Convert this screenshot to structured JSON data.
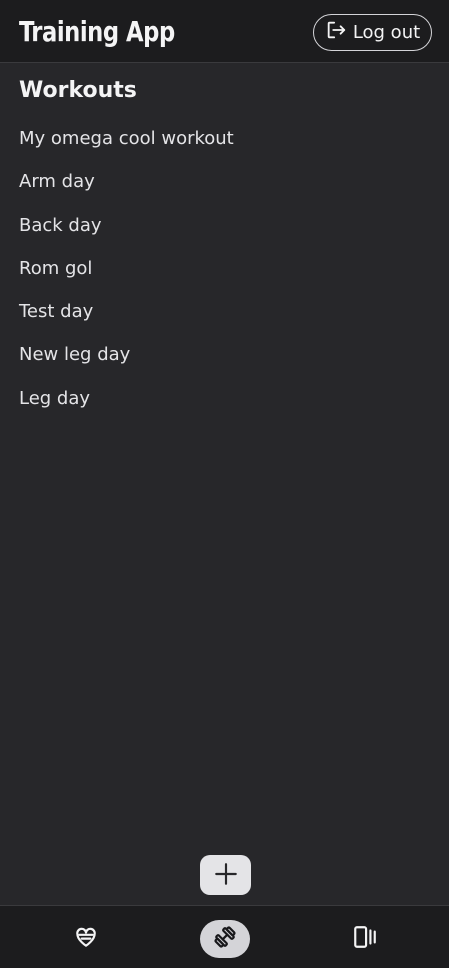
{
  "header": {
    "title": "Training App",
    "logout_label": "Log out",
    "logout_icon": "logout-icon"
  },
  "main": {
    "section_title": "Workouts",
    "workouts": [
      "My omega cool workout",
      "Arm day",
      "Back day",
      "Rom gol",
      "Test day",
      "New leg day",
      "Leg day"
    ]
  },
  "add_button_icon": "plus-icon",
  "bottom_nav": [
    {
      "icon": "heart-icon",
      "active": false
    },
    {
      "icon": "dumbbell-icon",
      "active": true
    },
    {
      "icon": "cards-icon",
      "active": false
    }
  ],
  "colors": {
    "background": "#27272a",
    "header": "#1c1c1e",
    "text": "#e4e4e7",
    "active_pill": "#d4d4d8"
  }
}
